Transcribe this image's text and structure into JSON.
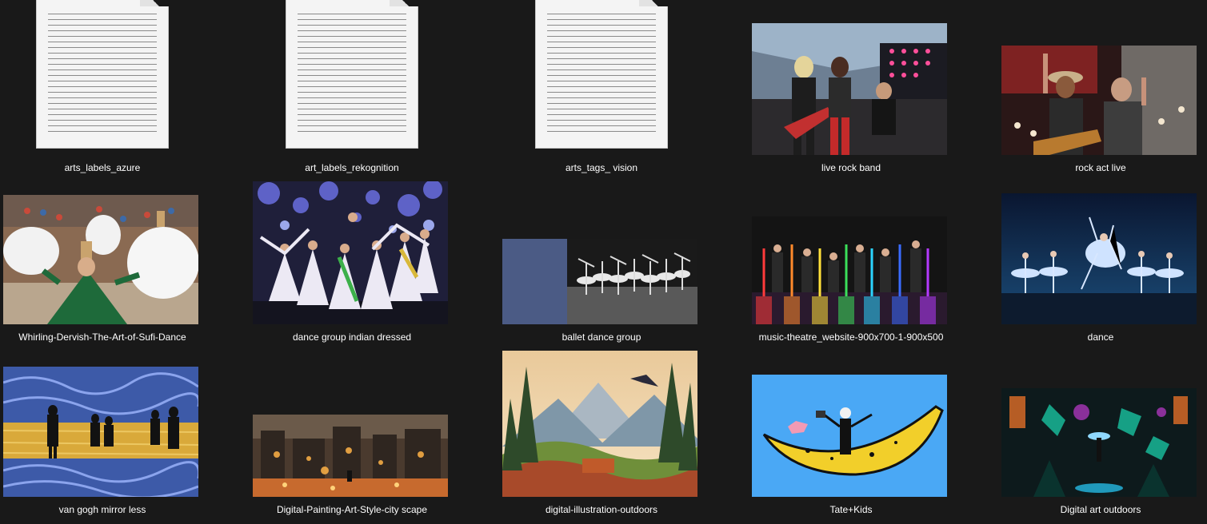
{
  "items": [
    {
      "name": "arts_labels_azure",
      "kind": "text-file"
    },
    {
      "name": "art_labels_rekognition",
      "kind": "text-file"
    },
    {
      "name": "arts_tags_ vision",
      "kind": "text-file"
    },
    {
      "name": "live rock band",
      "kind": "image"
    },
    {
      "name": "rock act live",
      "kind": "image"
    },
    {
      "name": "Whirling-Dervish-The-Art-of-Sufi-Dance",
      "kind": "image"
    },
    {
      "name": "dance group indian dressed",
      "kind": "image"
    },
    {
      "name": "ballet dance group",
      "kind": "image"
    },
    {
      "name": "music-theatre_website-900x700-1-900x500",
      "kind": "image"
    },
    {
      "name": "dance",
      "kind": "image"
    },
    {
      "name": "van gogh mirror less",
      "kind": "image"
    },
    {
      "name": "Digital-Painting-Art-Style-city scape",
      "kind": "image"
    },
    {
      "name": "digital-illustration-outdoors",
      "kind": "image"
    },
    {
      "name": "Tate+Kids",
      "kind": "image"
    },
    {
      "name": "Digital art outdoors",
      "kind": "image"
    }
  ],
  "colors": {
    "background": "#191919",
    "label_text": "#ffffff"
  }
}
